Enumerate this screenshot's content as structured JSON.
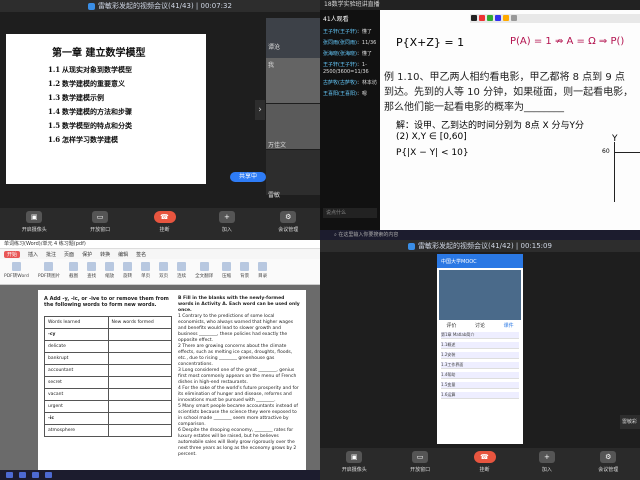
{
  "q1": {
    "title": "雷敏彩发起的视频会议(41/43) | 00:07:32",
    "chapter": "第一章 建立数学模型",
    "items": [
      {
        "num": "1.1",
        "text": "从现实对象到数学模型"
      },
      {
        "num": "1.2",
        "text": "数学建模的重要意义"
      },
      {
        "num": "1.3",
        "text": "数学建模示例"
      },
      {
        "num": "1.4",
        "text": "数学建模的方法和步骤"
      },
      {
        "num": "1.5",
        "text": "数学模型的特点和分类"
      },
      {
        "num": "1.6",
        "text": "怎样学习数学建模"
      }
    ],
    "tiles": [
      "谭沧",
      "我",
      "万佳文",
      "雷敏"
    ],
    "share_label": "共享中",
    "toolbar": [
      "开启摄像头",
      "开放窗口",
      "",
      "挂断",
      "加入",
      "会议管理",
      "",
      ""
    ]
  },
  "q2": {
    "title": "18数学实验班讲直播",
    "chat_header": "41人观看",
    "chat": [
      {
        "name": "王子轩(王子轩)",
        "msg": "懂了"
      },
      {
        "name": "张同雨(张同雨)",
        "msg": "11/36"
      },
      {
        "name": "张海晓(张海晓)",
        "msg": "懂了"
      },
      {
        "name": "王子轩(王子轩)",
        "msg": "1-2500/3600=11/36"
      },
      {
        "name": "古萨牧(古萨牧)",
        "msg": "林本坊"
      },
      {
        "name": "王喜阳(王喜阳)",
        "msg": "嗯"
      }
    ],
    "chat_placeholder": "说点什么",
    "send_label": "发送",
    "hand_line1": "P{X+Z} = 1",
    "hand_line2": "P(A) = 1  ⇏  A = Ω ⇒ P()",
    "problem": "例 1.10、甲乙两人相约看电影，甲乙都将 8 点到 9 点到达。先到的人等 10 分钟，如果碰面，则一起看电影，那么他们能一起看电影的概率为________",
    "solution": "解：设甲、乙到达的时间分别为 8点 X 分与Y分",
    "cond1": "(2) X,Y ∈ [0,60]",
    "cond2": "P{|X − Y| < 10}",
    "axis_y": "Y",
    "axis_y60": "60"
  },
  "q3": {
    "title": "单词练习(Word)/单元 4 练习题(pdf)",
    "menu": [
      "开始",
      "插入",
      "批注",
      "页面",
      "保护",
      "转换",
      "编辑",
      "签名"
    ],
    "ribbon": [
      "PDF转Word",
      "PDF转图片",
      "截图",
      "查找",
      "缩放",
      "旋转",
      "单页",
      "双页",
      "连续",
      "全文翻译",
      "压缩",
      "背景",
      "目录"
    ],
    "ex_a": "A  Add -y, -ic, or -ive to or remove them from the following words to form new words.",
    "th1": "Words learned",
    "th2": "New words formed",
    "words": [
      "-cy",
      "delicate",
      "bankrupt",
      "accountant",
      "secret",
      "vacant",
      "urgent",
      "-ic",
      "atmosphere"
    ],
    "ex_b": "B  Fill in the blanks with the newly-formed words in Activity A. Each word can be used only once.",
    "b_items": [
      "1  Contrary to the predictions of some local economists, who always warned that higher wages and benefits would lead to slower growth and business ________, these policies had exactly the opposite effect.",
      "2  There are growing concerns about the climate effects, such as melting ice caps, droughts, floods, etc., due to rising ________ greenhouse gas concentrations.",
      "3  Long considered one of the great ________, genius first most commonly appears on the menu of French dishes in high-end restaurants.",
      "4  For the sake of the world's future prosperity and for its elimination of hunger and disease, reforms and innovations must be pursued with ________.",
      "5  Many smart people became accountants instead of scientists because the science they were exposed to in school made ________ seem more attractive by comparison.",
      "6  Despite the drooping economy, ________ rates for luxury estates will be raised, but he believes automobile sales will likely grow rigorously over the next three years as long as the economy grows by 2 percent."
    ]
  },
  "q4": {
    "search_placeholder": "在这里输入你要搜索的内容",
    "title": "雷敏彩发起的视频会议(41/42) | 00:15:09",
    "app_title": "中国大学MOOC",
    "tabs": [
      "评价",
      "讨论",
      "课件"
    ],
    "rows": [
      "第1章 Matlab简介",
      "1.1概述",
      "1.2安装",
      "1.3工作界面",
      "1.4帮助",
      "1.5变量",
      "1.6运算"
    ],
    "side_name": "雷敏彩",
    "toolbar": [
      "开启摄像头",
      "开放窗口",
      "",
      "挂断",
      "加入",
      "会议管理",
      "",
      ""
    ]
  }
}
